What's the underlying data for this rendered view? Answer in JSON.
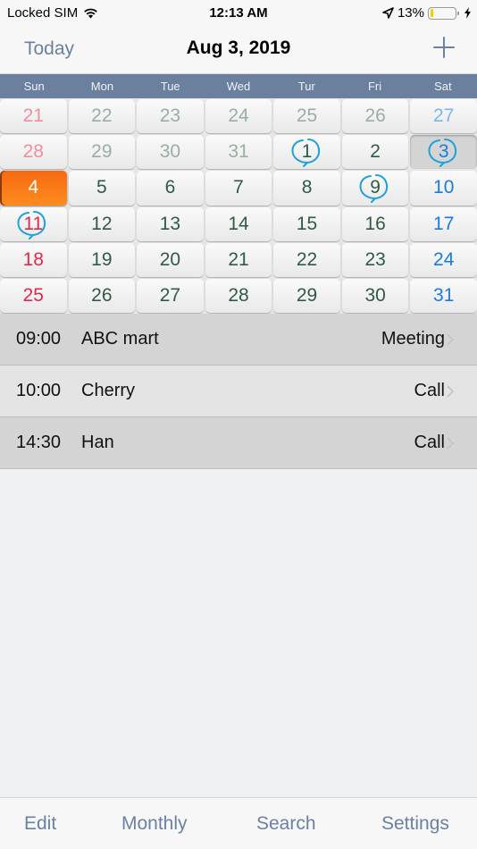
{
  "status_bar": {
    "carrier": "Locked SIM",
    "wifi_icon": "wifi-icon",
    "time": "12:13 AM",
    "location_icon": "location-arrow-icon",
    "battery_percent": "13%",
    "battery_level": 0.13,
    "charging_icon": "bolt-icon"
  },
  "navbar": {
    "today_label": "Today",
    "title": "Aug 3, 2019",
    "add_icon": "plus-icon"
  },
  "calendar": {
    "weekdays": [
      "Sun",
      "Mon",
      "Tue",
      "Wed",
      "Tur",
      "Fri",
      "Sat"
    ],
    "accent_colors": {
      "sunday": "#e0284a",
      "saturday": "#1a7ae0",
      "weekday": "#2f5b45",
      "today_bg": "#f56a12",
      "ring": "#1ea0d8"
    },
    "weeks": [
      [
        {
          "d": "21",
          "other": true
        },
        {
          "d": "22",
          "other": true
        },
        {
          "d": "23",
          "other": true
        },
        {
          "d": "24",
          "other": true
        },
        {
          "d": "25",
          "other": true
        },
        {
          "d": "26",
          "other": true
        },
        {
          "d": "27",
          "other": true
        }
      ],
      [
        {
          "d": "28",
          "other": true
        },
        {
          "d": "29",
          "other": true
        },
        {
          "d": "30",
          "other": true
        },
        {
          "d": "31",
          "other": true
        },
        {
          "d": "1",
          "event": true
        },
        {
          "d": "2"
        },
        {
          "d": "3",
          "event": true,
          "selected": true
        }
      ],
      [
        {
          "d": "4",
          "today": true
        },
        {
          "d": "5"
        },
        {
          "d": "6"
        },
        {
          "d": "7"
        },
        {
          "d": "8"
        },
        {
          "d": "9",
          "event": true
        },
        {
          "d": "10"
        }
      ],
      [
        {
          "d": "11",
          "event": true
        },
        {
          "d": "12"
        },
        {
          "d": "13"
        },
        {
          "d": "14"
        },
        {
          "d": "15"
        },
        {
          "d": "16"
        },
        {
          "d": "17"
        }
      ],
      [
        {
          "d": "18"
        },
        {
          "d": "19"
        },
        {
          "d": "20"
        },
        {
          "d": "21"
        },
        {
          "d": "22"
        },
        {
          "d": "23"
        },
        {
          "d": "24"
        }
      ],
      [
        {
          "d": "25"
        },
        {
          "d": "26"
        },
        {
          "d": "27"
        },
        {
          "d": "28"
        },
        {
          "d": "29"
        },
        {
          "d": "30"
        },
        {
          "d": "31"
        }
      ]
    ]
  },
  "events": [
    {
      "time": "09:00",
      "name": "ABC mart",
      "type": "Meeting"
    },
    {
      "time": "10:00",
      "name": "Cherry",
      "type": "Call"
    },
    {
      "time": "14:30",
      "name": "Han",
      "type": "Call"
    }
  ],
  "tabbar": {
    "edit": "Edit",
    "monthly": "Monthly",
    "search": "Search",
    "settings": "Settings"
  }
}
